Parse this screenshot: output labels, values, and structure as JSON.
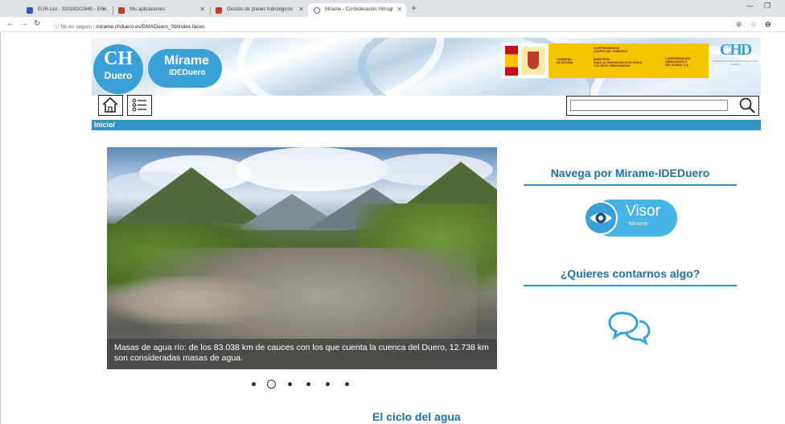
{
  "browser": {
    "tabs": [
      {
        "title": "EUR-Lex - 32018DC0640 - EN -",
        "active": false,
        "favicon_color": "#2a5db0"
      },
      {
        "title": "Mis aplicaciones",
        "active": false,
        "favicon_color": "#c0392b"
      },
      {
        "title": "Gestión de planes hidrológicos",
        "active": false,
        "favicon_color": "#c0392b"
      },
      {
        "title": "Mírame - Confederación hidrogr",
        "active": true,
        "favicon_color": "#5f6368"
      }
    ],
    "url_insecure_label": "No es seguro",
    "url": "mirame.chduero.es/DMADuero_09/index.faces"
  },
  "header": {
    "logo_ch": "CH",
    "logo_duero": "Duero",
    "logo_mirame": "Mírame",
    "logo_ideduero": "IDEDuero",
    "gov_left": "GOBIERNO\nDE ESPAÑA",
    "gov_vice": "VICEPRESIDENCIA\nCUARTA DEL GOBIERNO",
    "gov_ministry": "MINISTERIO\nPARA LA TRANSICIÓN ECOLÓGICA\nY EL RETO DEMOGRÁFICO",
    "gov_conf": "CONFEDERACIÓN\nHIDROGRÁFICA\nDEL DUERO, O.A.",
    "chd_letters": "CHD",
    "chd_sub": "CONFEDERACIÓN HIDROGRÁFICA DEL DUERO"
  },
  "icons": {
    "home": "home-icon",
    "menu": "list-menu-icon",
    "search": "search-icon",
    "chat": "chat-bubbles-icon",
    "eye": "eye-icon"
  },
  "search": {
    "value": "",
    "placeholder": ""
  },
  "breadcrumb": "Inicio/",
  "carousel": {
    "caption": "Masas de agua río: de los 83.038 km de cauces con los que cuenta la cuenca del Duero, 12.738 km son consideradas masas de agua.",
    "slide_count": 6,
    "active_index": 1
  },
  "sidebar": {
    "navega_title": "Navega por Mirame-IDEDuero",
    "visor_label": "Visor",
    "visor_sub": "Mirame",
    "contact_title": "¿Quieres contarnos algo?"
  },
  "section": {
    "title": "El ciclo del agua"
  },
  "colors": {
    "accent": "#2e93c6",
    "title_blue": "#1f6fa8",
    "logo_blue": "#3aa0d8"
  }
}
